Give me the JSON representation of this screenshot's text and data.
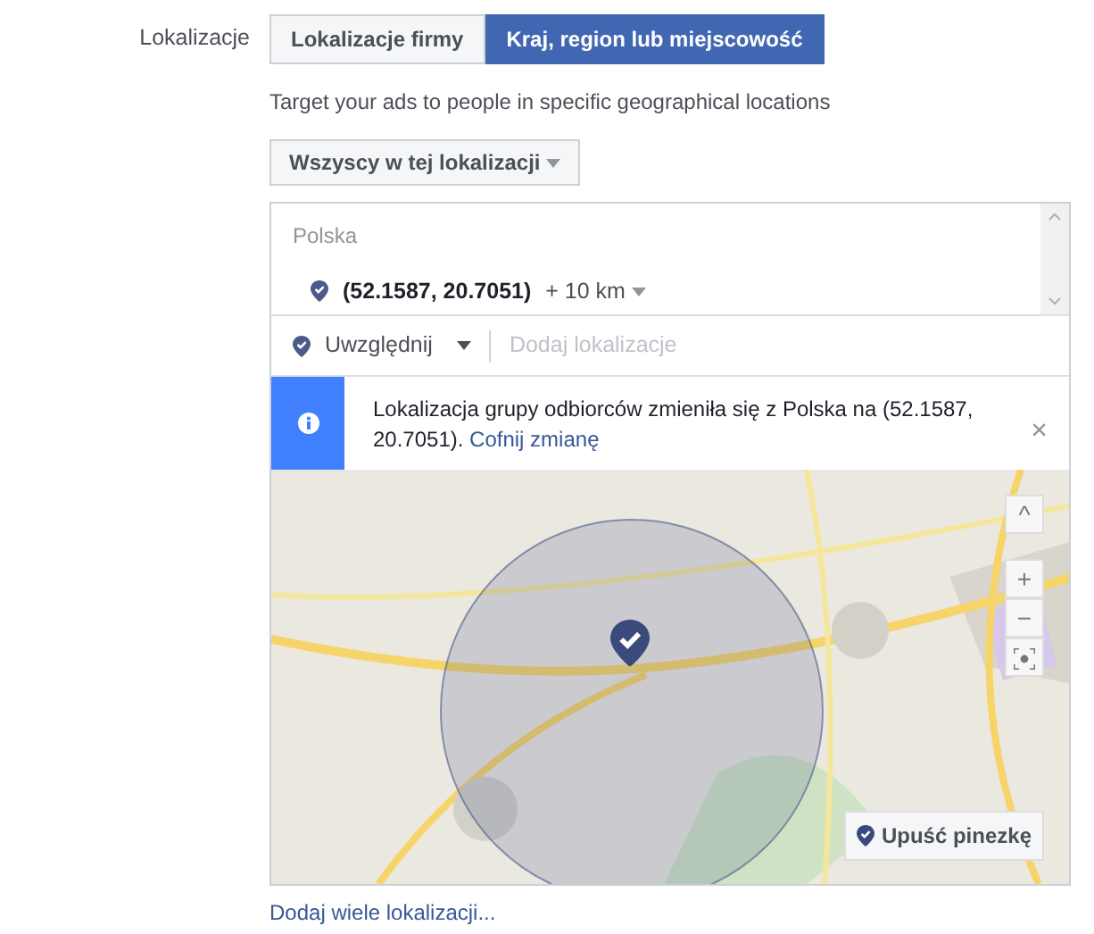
{
  "label": "Lokalizacje",
  "tabs": [
    {
      "label": "Lokalizacje firmy",
      "selected": false
    },
    {
      "label": "Kraj, region lub miejscowość",
      "selected": true
    }
  ],
  "description": "Target your ads to people in specific geographical locations",
  "audience_dropdown": "Wszyscy w tej lokalizacji",
  "locations": {
    "country": "Polska",
    "items": [
      {
        "name": "(52.1587, 20.7051)",
        "radius": "+ 10 km"
      }
    ]
  },
  "include_dropdown": "Uwzględnij",
  "search": {
    "placeholder": "Dodaj lokalizacje"
  },
  "notice": {
    "text": "Lokalizacja grupy odbiorców zmieniła się z Polska na (52.1587, 20.7051).",
    "link": "Cofnij zmianę",
    "close": "×"
  },
  "map": {
    "kind": "picture",
    "controls": [
      "^",
      "+",
      "−"
    ],
    "drop_pin": "Upuść pinezkę"
  },
  "bulk_link": "Dodaj wiele lokalizacji..."
}
